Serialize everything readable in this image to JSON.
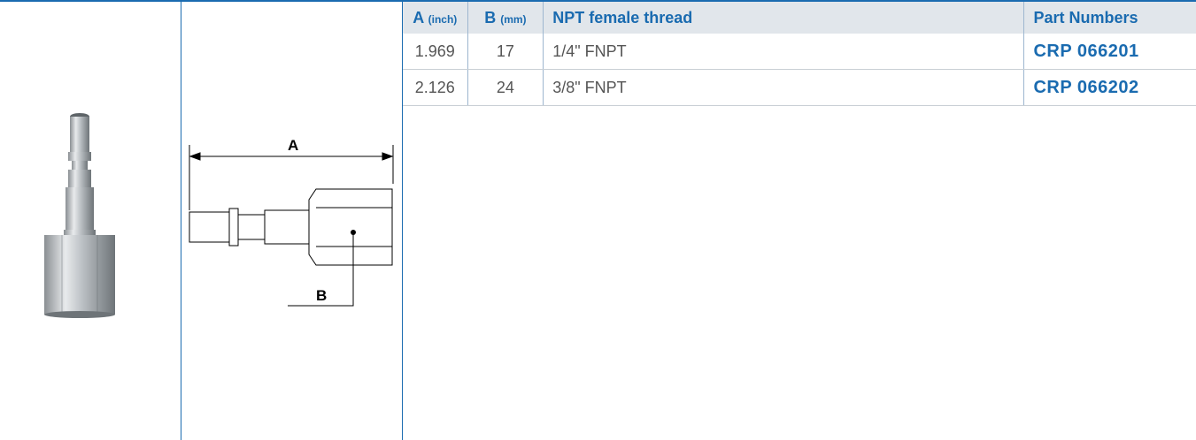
{
  "table": {
    "headers": {
      "a_main": "A",
      "a_unit": "(inch)",
      "b_main": "B",
      "b_unit": "(mm)",
      "thread": "NPT female thread",
      "parts": "Part Numbers"
    },
    "rows": [
      {
        "a": "1.969",
        "b": "17",
        "thread": "1/4\" FNPT",
        "part": "CRP 066201"
      },
      {
        "a": "2.126",
        "b": "24",
        "thread": "3/8\" FNPT",
        "part": "CRP 066202"
      }
    ]
  },
  "drawing": {
    "label_a": "A",
    "label_b": "B"
  },
  "colors": {
    "accent": "#1a6bb0",
    "header_bg": "#e1e6eb"
  }
}
